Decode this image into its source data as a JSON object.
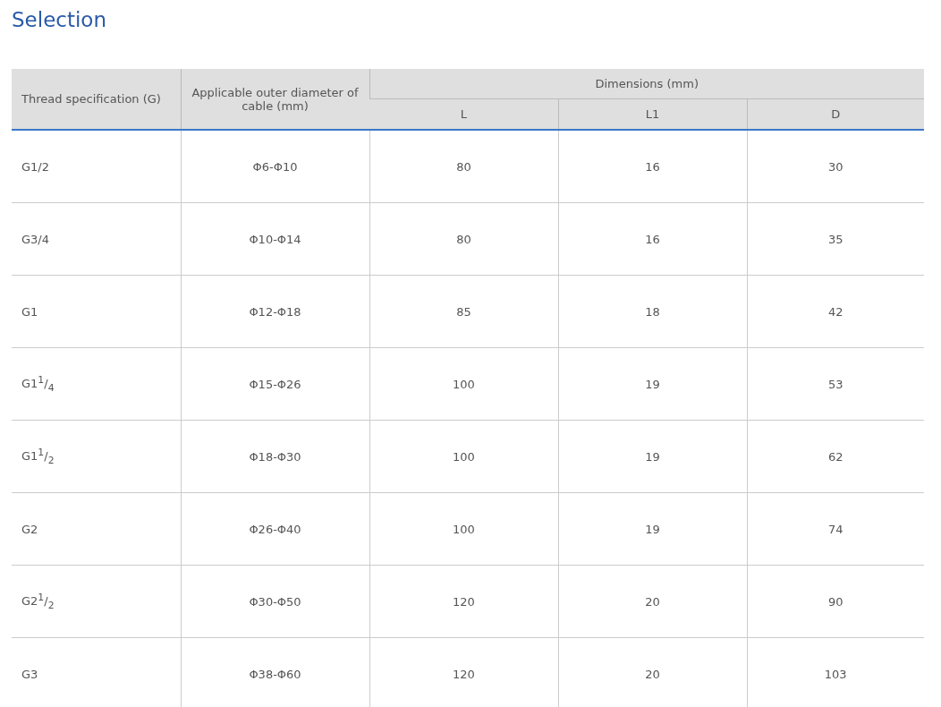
{
  "title": "Selection",
  "table": {
    "columns": [
      "Thread specification (G)",
      "Applicable outer diameter of cable (mm)"
    ],
    "group": {
      "label": "Dimensions (mm)",
      "columns": [
        "L",
        "L1",
        "D"
      ]
    },
    "rows": [
      [
        "G1/2",
        "Φ6-Φ10",
        "80",
        "16",
        "30"
      ],
      [
        "G3/4",
        "Φ10-Φ14",
        "80",
        "16",
        "35"
      ],
      [
        "G1",
        "Φ12-Φ18",
        "85",
        "18",
        "42"
      ],
      [
        "G1$^{1}$/$_{4}$",
        "Φ15-Φ26",
        "100",
        "19",
        "53"
      ],
      [
        "G1$^{1}$/$_{2}$",
        "Φ18-Φ30",
        "100",
        "19",
        "62"
      ],
      [
        "G2",
        "Φ26-Φ40",
        "100",
        "19",
        "74"
      ],
      [
        "G2$^{1}$/$_{2}$",
        "Φ30-Φ50",
        "120",
        "20",
        "90"
      ],
      [
        "G3",
        "Φ38-Φ60",
        "120",
        "20",
        "103"
      ]
    ]
  }
}
